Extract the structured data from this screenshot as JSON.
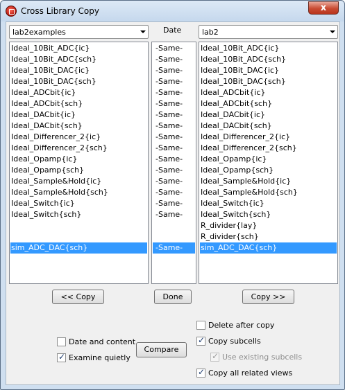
{
  "window": {
    "title": "Cross Library Copy",
    "close_glyph": "x"
  },
  "source": {
    "library": "lab2examples"
  },
  "date_header": "Date",
  "target": {
    "library": "lab2"
  },
  "left_list": [
    "Ideal_10Bit_ADC{ic}",
    "Ideal_10Bit_ADC{sch}",
    "Ideal_10Bit_DAC{ic}",
    "Ideal_10Bit_DAC{sch}",
    "Ideal_ADCbit{ic}",
    "Ideal_ADCbit{sch}",
    "Ideal_DACbit{ic}",
    "Ideal_DACbit{sch}",
    "Ideal_Differencer_2{ic}",
    "Ideal_Differencer_2{sch}",
    "Ideal_Opamp{ic}",
    "Ideal_Opamp{sch}",
    "Ideal_Sample&Hold{ic}",
    "Ideal_Sample&Hold{sch}",
    "Ideal_Switch{ic}",
    "Ideal_Switch{sch}",
    "",
    "",
    "sim_ADC_DAC{sch}"
  ],
  "mid_list": [
    "-Same-",
    "-Same-",
    "-Same-",
    "-Same-",
    "-Same-",
    "-Same-",
    "-Same-",
    "-Same-",
    "-Same-",
    "-Same-",
    "-Same-",
    "-Same-",
    "-Same-",
    "-Same-",
    "-Same-",
    "-Same-",
    "",
    "",
    "-Same-"
  ],
  "right_list": [
    "Ideal_10Bit_ADC{ic}",
    "Ideal_10Bit_ADC{sch}",
    "Ideal_10Bit_DAC{ic}",
    "Ideal_10Bit_DAC{sch}",
    "Ideal_ADCbit{ic}",
    "Ideal_ADCbit{sch}",
    "Ideal_DACbit{ic}",
    "Ideal_DACbit{sch}",
    "Ideal_Differencer_2{ic}",
    "Ideal_Differencer_2{sch}",
    "Ideal_Opamp{ic}",
    "Ideal_Opamp{sch}",
    "Ideal_Sample&Hold{ic}",
    "Ideal_Sample&Hold{sch}",
    "Ideal_Switch{ic}",
    "Ideal_Switch{sch}",
    "R_divider{lay}",
    "R_divider{sch}",
    "sim_ADC_DAC{sch}"
  ],
  "selected_index": 18,
  "buttons": {
    "copy_left": "<< Copy",
    "done": "Done",
    "copy_right": "Copy >>",
    "compare": "Compare"
  },
  "options": {
    "date_and_content": {
      "label": "Date and content",
      "checked": false
    },
    "examine_quietly": {
      "label": "Examine quietly",
      "checked": true
    },
    "delete_after_copy": {
      "label": "Delete after copy",
      "checked": false
    },
    "copy_subcells": {
      "label": "Copy subcells",
      "checked": true
    },
    "use_existing_subcells": {
      "label": "Use existing subcells",
      "checked": true,
      "disabled": true
    },
    "copy_all_related_views": {
      "label": "Copy all related views",
      "checked": true
    }
  },
  "colors": {
    "selection": "#3399ff",
    "client_bg": "#f0f0f0",
    "title_bg": "#cfdff0"
  }
}
